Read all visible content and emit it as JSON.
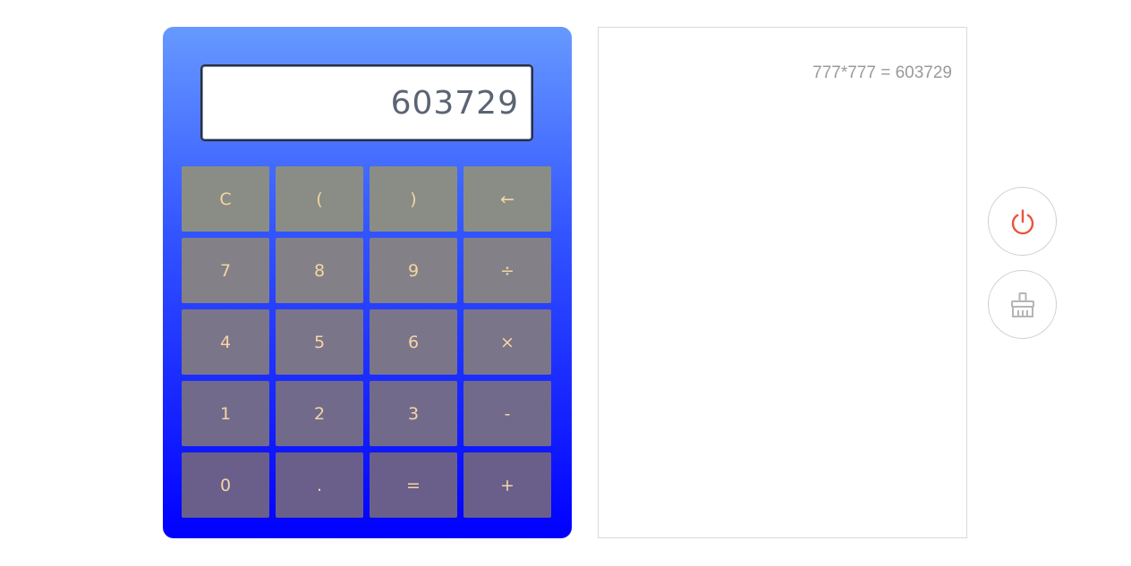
{
  "calculator": {
    "display": "603729",
    "keys": [
      [
        {
          "label": "C",
          "name": "clear-key"
        },
        {
          "label": "(",
          "name": "open-paren-key"
        },
        {
          "label": ")",
          "name": "close-paren-key"
        },
        {
          "label": "←",
          "name": "backspace-key"
        }
      ],
      [
        {
          "label": "7",
          "name": "digit-7-key"
        },
        {
          "label": "8",
          "name": "digit-8-key"
        },
        {
          "label": "9",
          "name": "digit-9-key"
        },
        {
          "label": "÷",
          "name": "divide-key"
        }
      ],
      [
        {
          "label": "4",
          "name": "digit-4-key"
        },
        {
          "label": "5",
          "name": "digit-5-key"
        },
        {
          "label": "6",
          "name": "digit-6-key"
        },
        {
          "label": "×",
          "name": "multiply-key"
        }
      ],
      [
        {
          "label": "1",
          "name": "digit-1-key"
        },
        {
          "label": "2",
          "name": "digit-2-key"
        },
        {
          "label": "3",
          "name": "digit-3-key"
        },
        {
          "label": "-",
          "name": "subtract-key"
        }
      ],
      [
        {
          "label": "0",
          "name": "digit-0-key"
        },
        {
          "label": ".",
          "name": "decimal-key"
        },
        {
          "label": "=",
          "name": "equals-key"
        },
        {
          "label": "+",
          "name": "add-key"
        }
      ]
    ]
  },
  "history": {
    "entries": [
      "777*777 = 603729"
    ]
  },
  "side_buttons": {
    "power_icon": "power-icon",
    "clear_icon": "broom-icon"
  },
  "colors": {
    "gradient_top": "#6699ff",
    "gradient_bottom": "#0000ff",
    "key_text": "#f3d6a4",
    "power_icon": "#e8553a",
    "clear_icon": "#b5b5b5"
  }
}
